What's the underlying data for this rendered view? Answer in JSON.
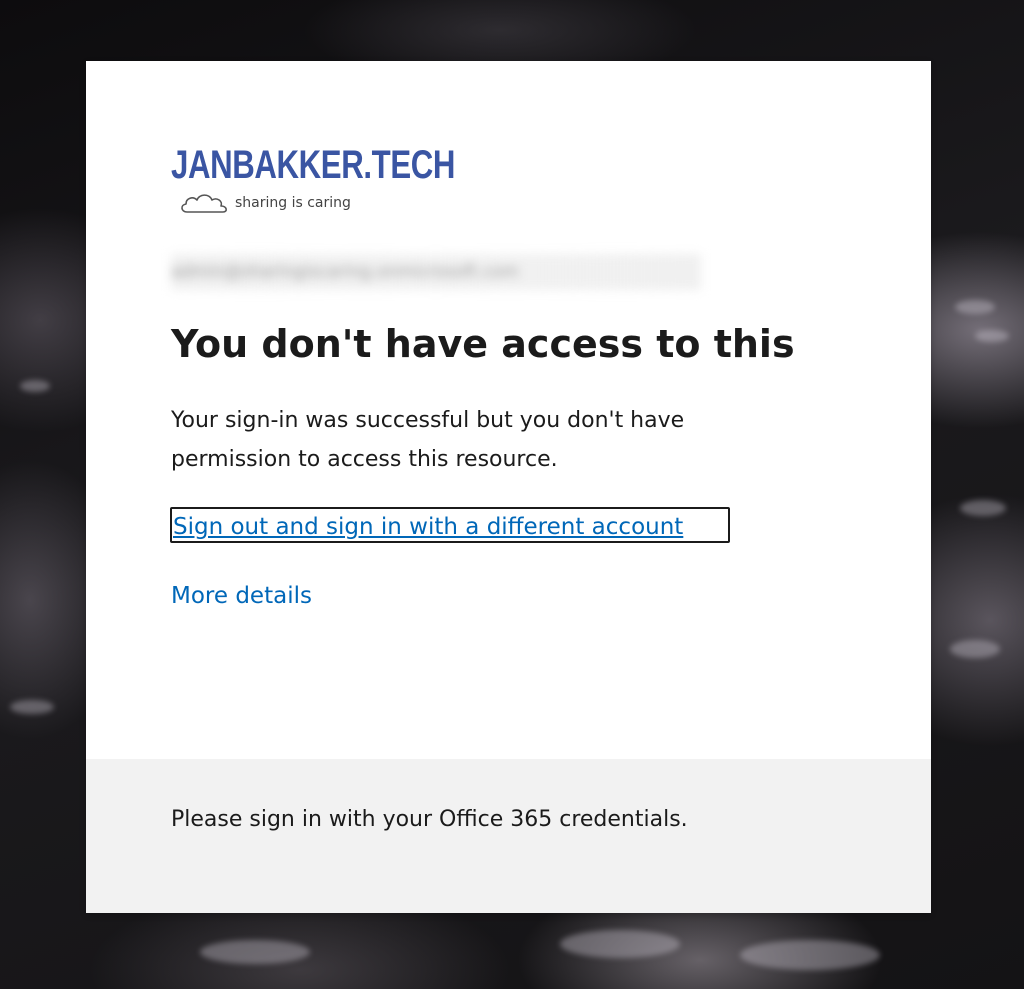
{
  "background": {
    "icon": "keyboard-bokeh-photo"
  },
  "logo": {
    "title": "JANBAKKER.TECH",
    "tagline": "sharing is caring",
    "icon": "cloud-icon",
    "color": "#3a55a3"
  },
  "account": {
    "email": "admin@sharingiscaring.onmicrosoft.com"
  },
  "main": {
    "title": "You don't have access to this",
    "message": "Your sign-in was successful but you don't have permission to access this resource.",
    "signout_link": "Sign out and sign in with a different account",
    "details_link": "More details",
    "link_color": "#0067b8"
  },
  "footer": {
    "text": "Please sign in with your Office 365 credentials."
  }
}
